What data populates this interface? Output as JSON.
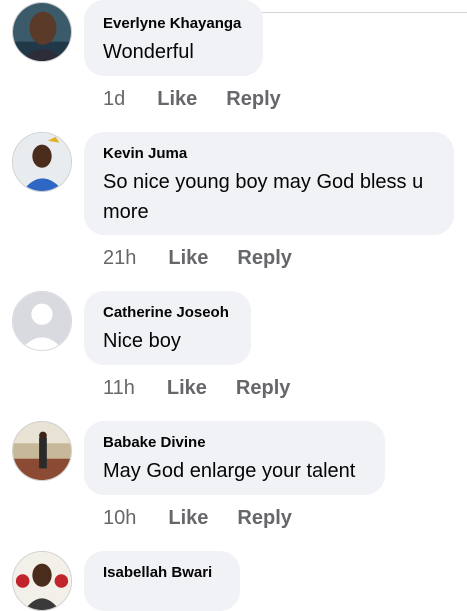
{
  "comments": [
    {
      "author": "Everlyne Khayanga",
      "text": "Wonderful",
      "time": "1d",
      "like": "Like",
      "reply": "Reply"
    },
    {
      "author": "Kevin Juma",
      "text": "So nice young boy may God bless u more",
      "time": "21h",
      "like": "Like",
      "reply": "Reply"
    },
    {
      "author": "Catherine Joseoh",
      "text": "Nice boy",
      "time": "11h",
      "like": "Like",
      "reply": "Reply"
    },
    {
      "author": "Babake Divine",
      "text": "May God enlarge your talent",
      "time": "10h",
      "like": "Like",
      "reply": "Reply"
    },
    {
      "author": "Isabellah Bwari",
      "text": "",
      "time": "",
      "like": "",
      "reply": ""
    }
  ],
  "colors": {
    "bubble": "#f0f2f5",
    "meta_text": "#65676b",
    "body_text": "#050505",
    "default_avatar": "#d8dadf"
  }
}
